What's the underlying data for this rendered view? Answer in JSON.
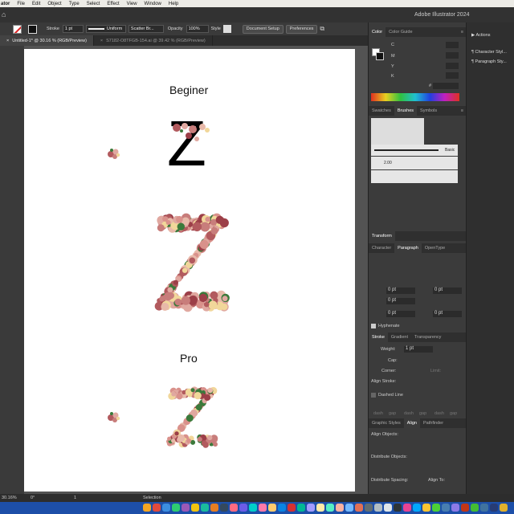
{
  "menubar": {
    "items": [
      "ator",
      "File",
      "Edit",
      "Object",
      "Type",
      "Select",
      "Effect",
      "View",
      "Window",
      "Help"
    ]
  },
  "app": {
    "title": "Adobe Illustrator 2024"
  },
  "controlbar": {
    "stroke_label": "Stroke",
    "stroke_weight": "1 pt",
    "profile": "Uniform",
    "brush": "Scatter Br...",
    "opacity_label": "Opacity",
    "opacity": "100%",
    "style_label": "Style",
    "doc_setup": "Document Setup",
    "preferences": "Preferences"
  },
  "tabs": [
    {
      "label": "Untitled-1* @ 30.16 % (RGB/Preview)"
    },
    {
      "label": "S7182-O8TFGB-154.ai @ 39.42 % (RGB/Preview)"
    }
  ],
  "artboard": {
    "beginner_label": "Beginer",
    "pro_label": "Pro",
    "letter": "Z"
  },
  "color_panel": {
    "tabs": [
      "Color",
      "Color Guide"
    ],
    "channels": [
      "C",
      "M",
      "Y",
      "K"
    ],
    "hash": "#"
  },
  "brushes_panel": {
    "tabs": [
      "Swatches",
      "Brushes",
      "Symbols"
    ],
    "basic_label": "Basic",
    "size": "2.00"
  },
  "transform_panel": {
    "title": "Transform"
  },
  "paragraph_panel": {
    "tabs": [
      "Character",
      "Paragraph",
      "OpenType"
    ],
    "indent_left": "0 pt",
    "indent_right": "0 pt",
    "first_line": "0 pt",
    "space_before": "0 pt",
    "space_after": "0 pt",
    "hyphenate": "Hyphenate"
  },
  "stroke_panel": {
    "tabs": [
      "Stroke",
      "Gradient",
      "Transparency"
    ],
    "weight_label": "Weight:",
    "weight": "1 pt",
    "cap_label": "Cap:",
    "corner_label": "Corner:",
    "limit_label": "Limit:",
    "align_label": "Align Stroke:",
    "dashed_label": "Dashed Line",
    "dash_cols": [
      "dash",
      "gap",
      "dash",
      "gap",
      "dash",
      "gap"
    ]
  },
  "align_panel": {
    "tabs": [
      "Graphic Styles",
      "Align",
      "Pathfinder"
    ],
    "align_objects": "Align Objects:",
    "distribute_objects": "Distribute Objects:",
    "distribute_spacing": "Distribute Spacing:",
    "align_to": "Align To:"
  },
  "far_panel": {
    "items": [
      "Actions",
      "Character Styl...",
      "Paragraph Sty..."
    ]
  },
  "status": {
    "zoom": "30.16%",
    "rotation": "0°",
    "artboard": "1",
    "tool": "Selection"
  },
  "colors": {
    "accent": "#1d4fa8",
    "panel": "#3b3b3b",
    "artboard": "#ffffff"
  }
}
